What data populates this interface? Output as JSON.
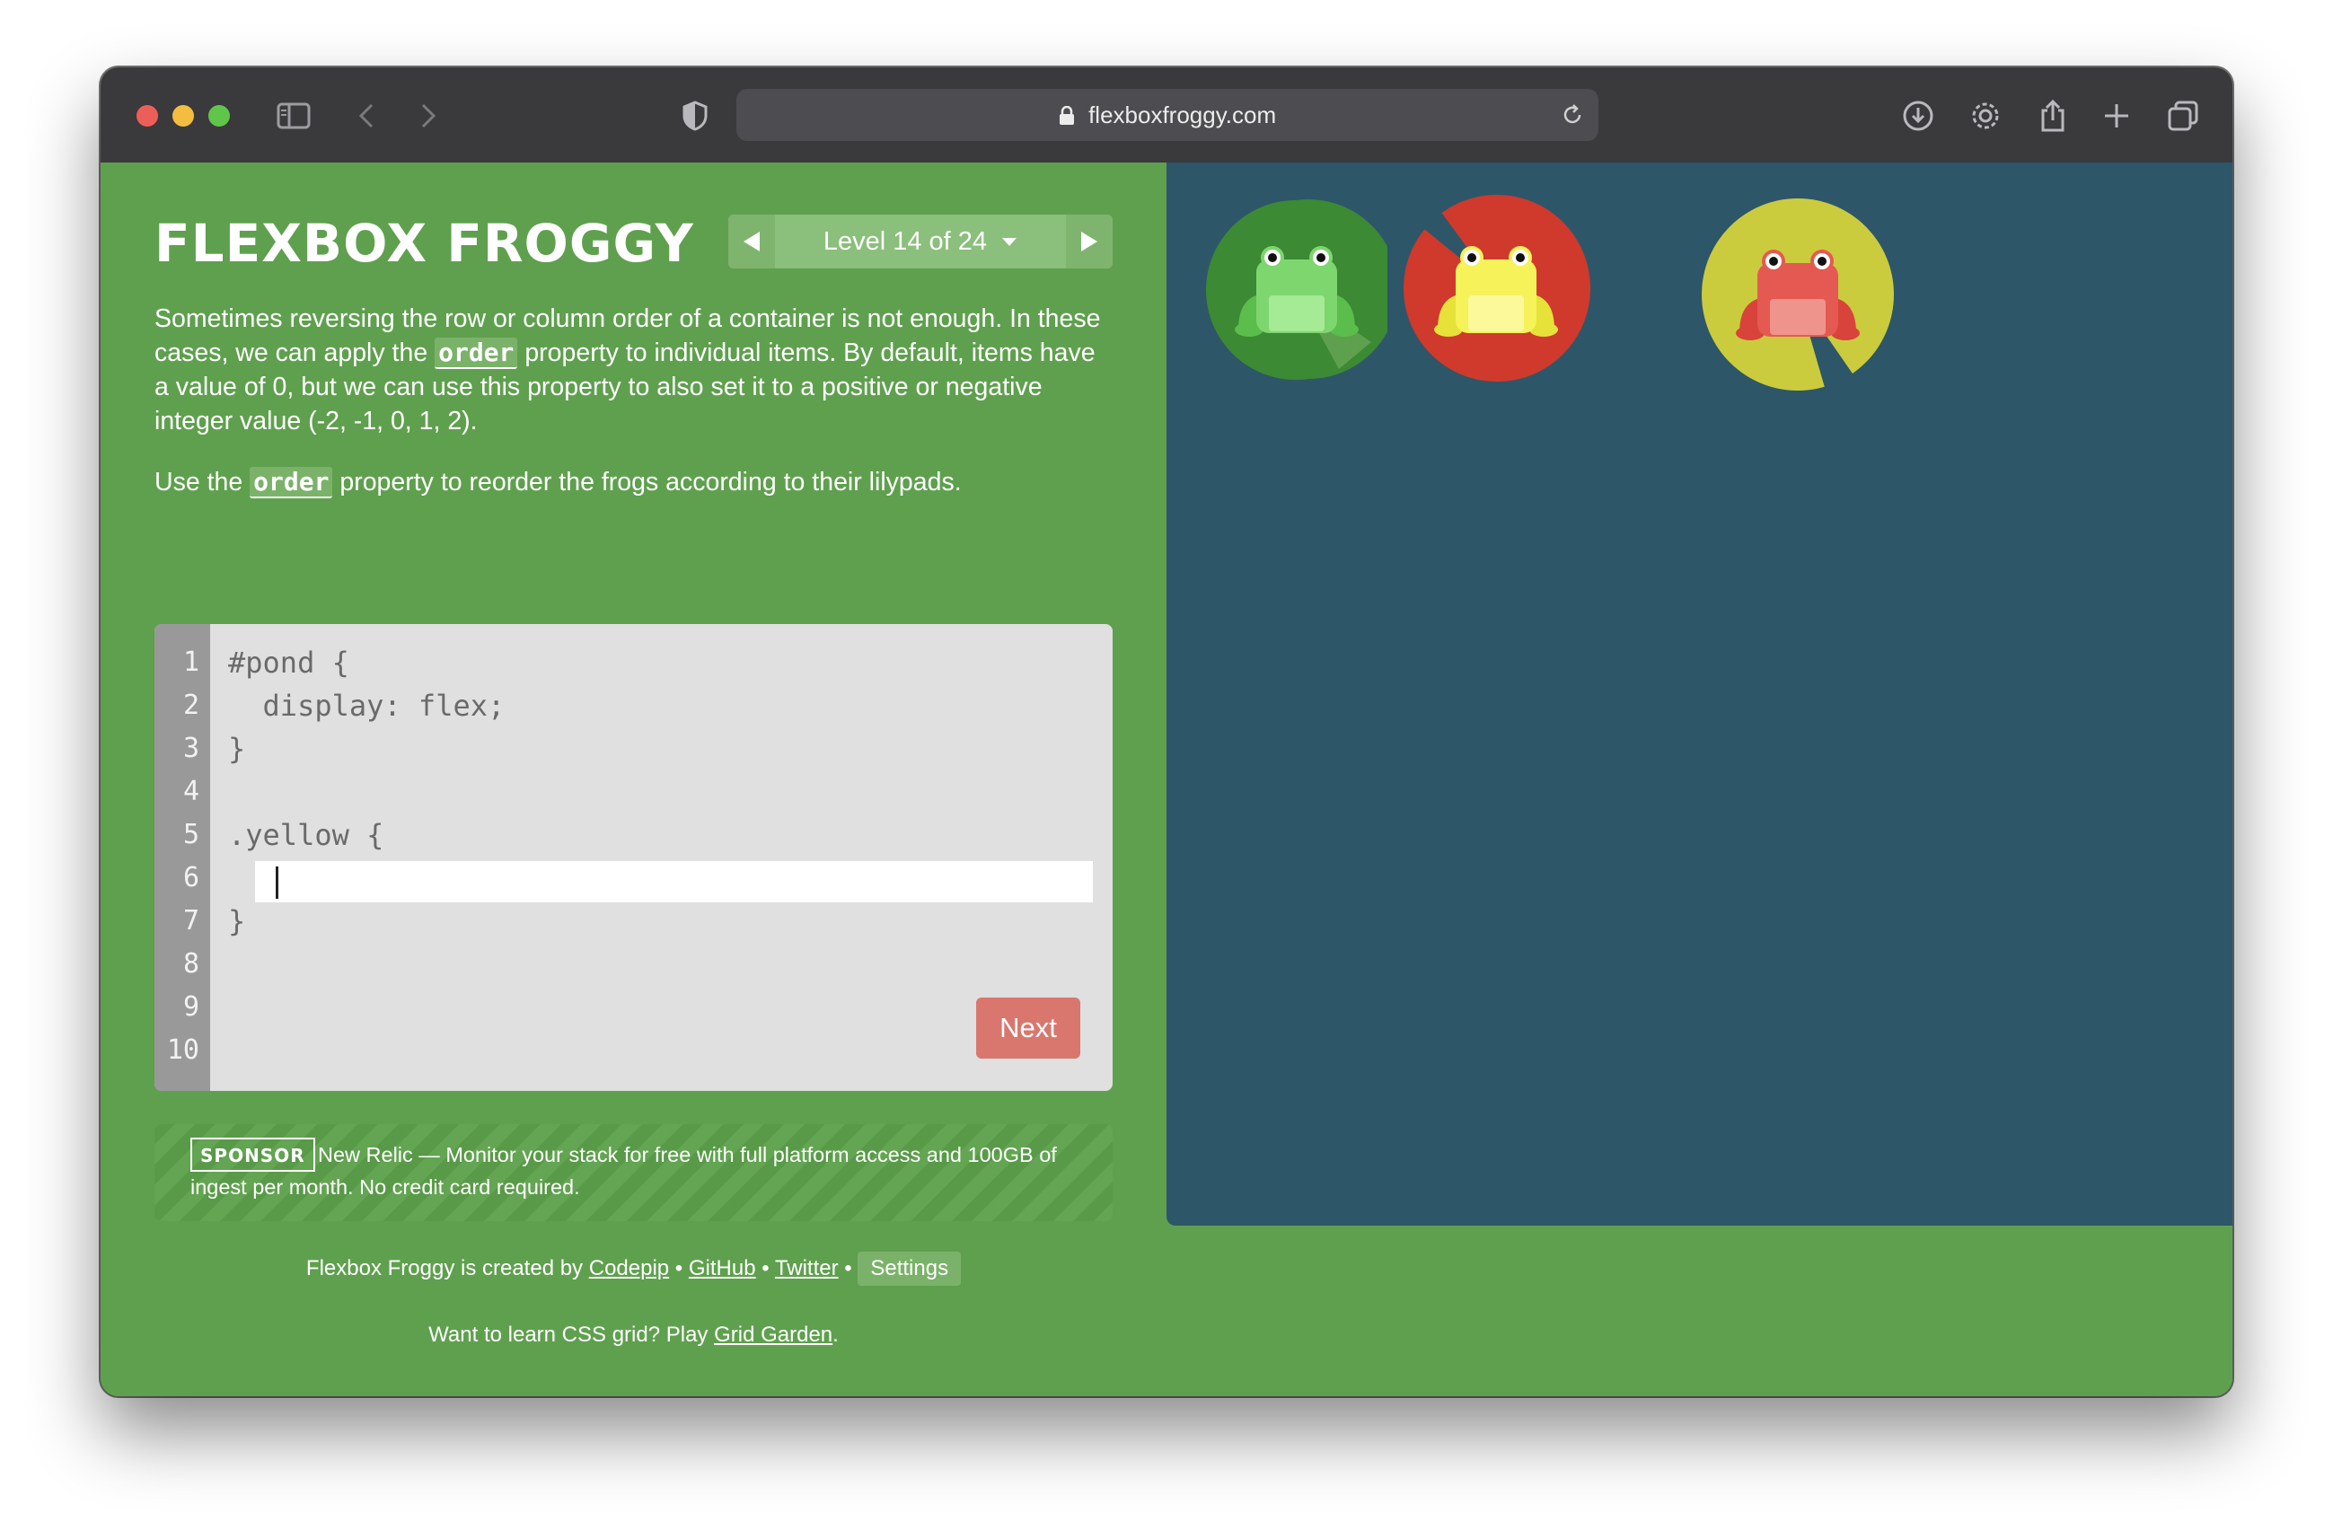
{
  "browser": {
    "url": "flexboxfroggy.com"
  },
  "game": {
    "title": "FLEXBOX FROGGY",
    "level_label": "Level 14 of 24",
    "intro_1a": "Sometimes reversing the row or column order of a container is not enough. In these cases, we can apply the ",
    "intro_1_code": "order",
    "intro_1b": " property to individual items. By default, items have a value of 0, but we can use this property to also set it to a positive or negative integer value (-2, -1, 0, 1, 2).",
    "intro_2a": "Use the ",
    "intro_2_code": "order",
    "intro_2b": " property to reorder the frogs according to their lilypads."
  },
  "editor": {
    "line_numbers": [
      "1",
      "2",
      "3",
      "4",
      "5",
      "6",
      "7",
      "8",
      "9",
      "10"
    ],
    "lines": {
      "l1": "#pond {",
      "l2": "  display: flex;",
      "l3": "}",
      "l4": "",
      "l5": ".yellow {",
      "l7": "}"
    },
    "input_value": "",
    "next_label": "Next"
  },
  "sponsor": {
    "tag": "SPONSOR",
    "text": "New Relic — Monitor your stack for free with full platform access and 100GB of ingest per month. No credit card required."
  },
  "footer": {
    "credit_prefix": "Flexbox Froggy is created by ",
    "codepip": "Codepip",
    "sep1": " • ",
    "github": "GitHub",
    "sep2": " • ",
    "twitter": "Twitter",
    "sep3": " • ",
    "settings": "Settings",
    "grid_prefix": "Want to learn CSS grid? Play ",
    "grid_link": "Grid Garden",
    "grid_suffix": "."
  },
  "board": {
    "lilypads": [
      {
        "color": "green",
        "hex": "#3c8a33"
      },
      {
        "color": "red",
        "hex": "#cf3a2c"
      },
      {
        "color": "yellow",
        "hex": "#cbcb3e"
      }
    ],
    "frogs": [
      {
        "color": "green",
        "hex": "#7ed66f"
      },
      {
        "color": "yellow",
        "hex": "#f5f25a"
      },
      {
        "color": "red",
        "hex": "#e45a52"
      }
    ]
  },
  "colors": {
    "sidebar_bg": "#5fa04e",
    "board_bg": "#2e5669",
    "next_button": "#d9776f"
  }
}
